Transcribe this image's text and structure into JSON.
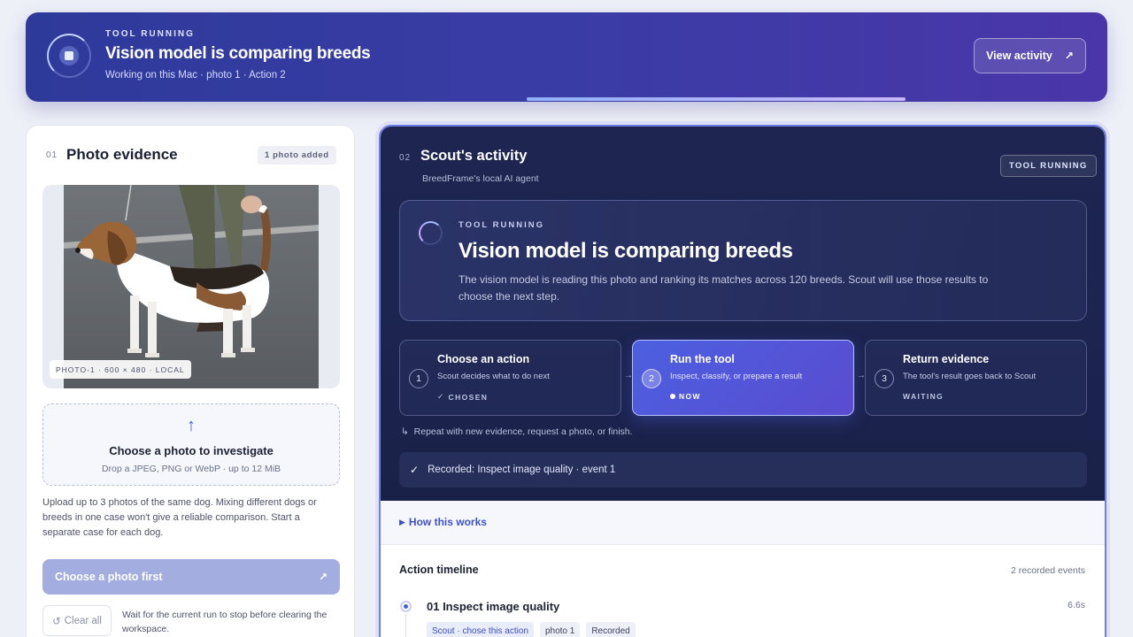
{
  "banner": {
    "eyebrow": "TOOL RUNNING",
    "title": "Vision model is comparing breeds",
    "subtitle": "Working on this Mac · photo 1 · Action 2",
    "button_label": "View activity",
    "progress": 0.35
  },
  "left": {
    "section_num": "01",
    "title": "Photo evidence",
    "count_badge": "1 photo added",
    "photo_tag": "PHOTO-1 · 600 × 480 · LOCAL",
    "dropzone": {
      "title": "Choose a photo to investigate",
      "subtitle": "Drop a JPEG, PNG or WebP · up to 12 MiB"
    },
    "note": "Upload up to 3 photos of the same dog. Mixing different dogs or breeds in one case won't give a reliable comparison. Start a separate case for each dog.",
    "primary_button": "Choose a photo first",
    "clear_button": "Clear all",
    "wait_note": "Wait for the current run to stop before clearing the workspace."
  },
  "right": {
    "section_num": "02",
    "title": "Scout's activity",
    "subtitle": "BreedFrame's local AI agent",
    "status_pill": "TOOL RUNNING",
    "status_card": {
      "eyebrow": "TOOL RUNNING",
      "title": "Vision model is comparing breeds",
      "description": "The vision model is reading this photo and ranking its matches across 120 breeds. Scout will use those results to choose the next step."
    },
    "steps": [
      {
        "num": "1",
        "title": "Choose an action",
        "desc": "Scout decides what to do next",
        "state": "CHOSEN"
      },
      {
        "num": "2",
        "title": "Run the tool",
        "desc": "Inspect, classify, or prepare a result",
        "state": "NOW"
      },
      {
        "num": "3",
        "title": "Return evidence",
        "desc": "The tool's result goes back to Scout",
        "state": "WAITING"
      }
    ],
    "repeat_note": "Repeat with new evidence, request a photo, or finish.",
    "recorded": "Recorded: Inspect image quality · event 1",
    "how_link": "How this works",
    "timeline": {
      "title": "Action timeline",
      "count": "2 recorded events",
      "events": [
        {
          "title": "01 Inspect image quality",
          "time": "6.6s",
          "chips": [
            "Scout · chose this action",
            "photo 1",
            "Recorded"
          ]
        }
      ]
    }
  }
}
